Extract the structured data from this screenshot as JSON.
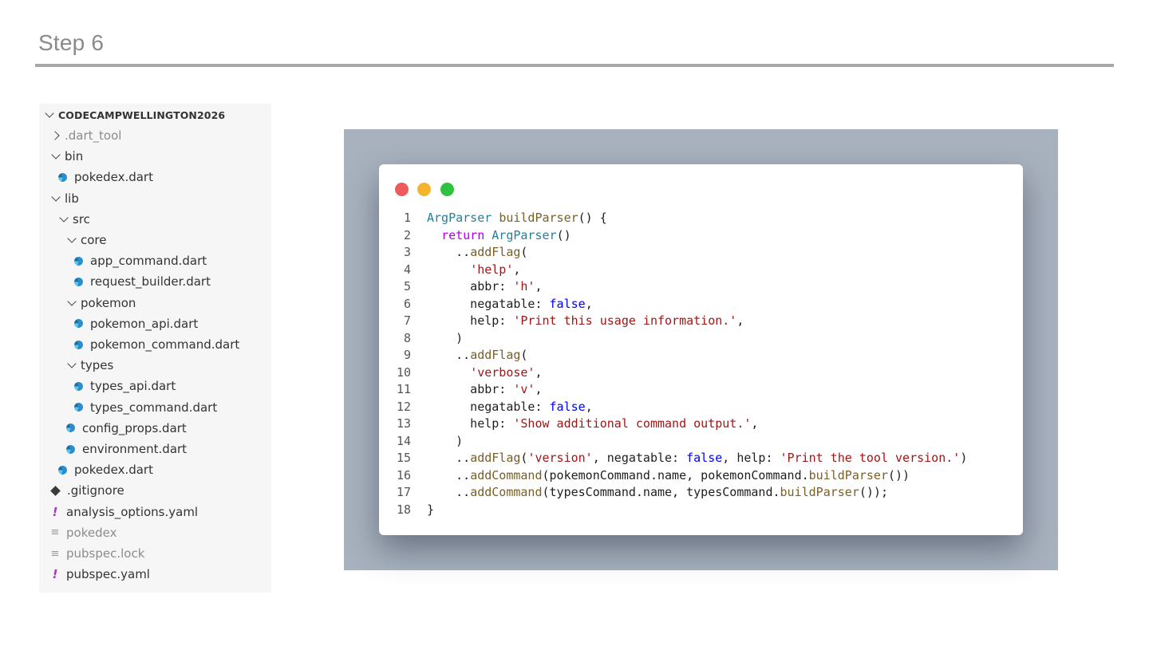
{
  "slide": {
    "title": "Step 6"
  },
  "explorer": {
    "root": "CODECAMPWELLINGTON2026",
    "items": [
      {
        "label": ".dart_tool",
        "kind": "folder",
        "open": false,
        "depth": 1,
        "dim": true
      },
      {
        "label": "bin",
        "kind": "folder",
        "open": true,
        "depth": 1
      },
      {
        "label": "pokedex.dart",
        "kind": "dart",
        "depth": 2
      },
      {
        "label": "lib",
        "kind": "folder",
        "open": true,
        "depth": 1
      },
      {
        "label": "src",
        "kind": "folder",
        "open": true,
        "depth": 2
      },
      {
        "label": "core",
        "kind": "folder",
        "open": true,
        "depth": 3
      },
      {
        "label": "app_command.dart",
        "kind": "dart",
        "depth": 4
      },
      {
        "label": "request_builder.dart",
        "kind": "dart",
        "depth": 4
      },
      {
        "label": "pokemon",
        "kind": "folder",
        "open": true,
        "depth": 3
      },
      {
        "label": "pokemon_api.dart",
        "kind": "dart",
        "depth": 4
      },
      {
        "label": "pokemon_command.dart",
        "kind": "dart",
        "depth": 4
      },
      {
        "label": "types",
        "kind": "folder",
        "open": true,
        "depth": 3
      },
      {
        "label": "types_api.dart",
        "kind": "dart",
        "depth": 4
      },
      {
        "label": "types_command.dart",
        "kind": "dart",
        "depth": 4
      },
      {
        "label": "config_props.dart",
        "kind": "dart",
        "depth": 3
      },
      {
        "label": "environment.dart",
        "kind": "dart",
        "depth": 3
      },
      {
        "label": "pokedex.dart",
        "kind": "dart",
        "depth": 2
      },
      {
        "label": ".gitignore",
        "kind": "git",
        "depth": 1
      },
      {
        "label": "analysis_options.yaml",
        "kind": "yaml",
        "depth": 1
      },
      {
        "label": "pokedex",
        "kind": "plain",
        "depth": 1,
        "dim": true
      },
      {
        "label": "pubspec.lock",
        "kind": "plain",
        "depth": 1,
        "dim": true
      },
      {
        "label": "pubspec.yaml",
        "kind": "yaml",
        "depth": 1
      }
    ]
  },
  "code": {
    "lines": [
      [
        [
          "type",
          "ArgParser"
        ],
        [
          "p",
          " "
        ],
        [
          "fn",
          "buildParser"
        ],
        [
          "p",
          "() {"
        ]
      ],
      [
        [
          "p",
          "  "
        ],
        [
          "kw",
          "return"
        ],
        [
          "p",
          " "
        ],
        [
          "type",
          "ArgParser"
        ],
        [
          "p",
          "()"
        ]
      ],
      [
        [
          "p",
          "    .."
        ],
        [
          "fn",
          "addFlag"
        ],
        [
          "p",
          "("
        ]
      ],
      [
        [
          "p",
          "      "
        ],
        [
          "str",
          "'help'"
        ],
        [
          "p",
          ","
        ]
      ],
      [
        [
          "p",
          "      abbr: "
        ],
        [
          "str",
          "'h'"
        ],
        [
          "p",
          ","
        ]
      ],
      [
        [
          "p",
          "      negatable: "
        ],
        [
          "bool",
          "false"
        ],
        [
          "p",
          ","
        ]
      ],
      [
        [
          "p",
          "      help: "
        ],
        [
          "str",
          "'Print this usage information.'"
        ],
        [
          "p",
          ","
        ]
      ],
      [
        [
          "p",
          "    )"
        ]
      ],
      [
        [
          "p",
          "    .."
        ],
        [
          "fn",
          "addFlag"
        ],
        [
          "p",
          "("
        ]
      ],
      [
        [
          "p",
          "      "
        ],
        [
          "str",
          "'verbose'"
        ],
        [
          "p",
          ","
        ]
      ],
      [
        [
          "p",
          "      abbr: "
        ],
        [
          "str",
          "'v'"
        ],
        [
          "p",
          ","
        ]
      ],
      [
        [
          "p",
          "      negatable: "
        ],
        [
          "bool",
          "false"
        ],
        [
          "p",
          ","
        ]
      ],
      [
        [
          "p",
          "      help: "
        ],
        [
          "str",
          "'Show additional command output.'"
        ],
        [
          "p",
          ","
        ]
      ],
      [
        [
          "p",
          "    )"
        ]
      ],
      [
        [
          "p",
          "    .."
        ],
        [
          "fn",
          "addFlag"
        ],
        [
          "p",
          "("
        ],
        [
          "str",
          "'version'"
        ],
        [
          "p",
          ", negatable: "
        ],
        [
          "bool",
          "false"
        ],
        [
          "p",
          ", help: "
        ],
        [
          "str",
          "'Print the tool version.'"
        ],
        [
          "p",
          ")"
        ]
      ],
      [
        [
          "p",
          "    .."
        ],
        [
          "fn",
          "addCommand"
        ],
        [
          "p",
          "(pokemonCommand.name, pokemonCommand."
        ],
        [
          "fn",
          "buildParser"
        ],
        [
          "p",
          "())"
        ]
      ],
      [
        [
          "p",
          "    .."
        ],
        [
          "fn",
          "addCommand"
        ],
        [
          "p",
          "(typesCommand.name, typesCommand."
        ],
        [
          "fn",
          "buildParser"
        ],
        [
          "p",
          "());"
        ]
      ],
      [
        [
          "p",
          "}"
        ]
      ]
    ]
  }
}
